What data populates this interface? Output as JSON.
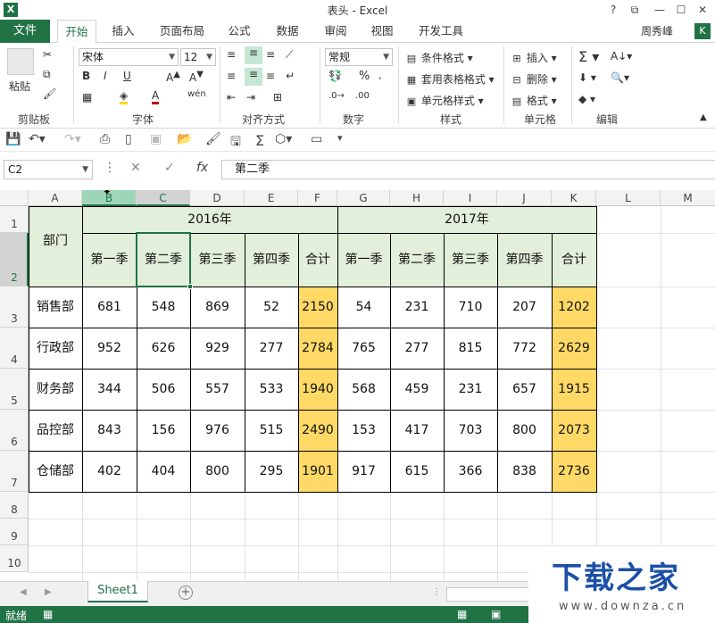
{
  "window": {
    "title": "表头 - Excel",
    "app_icon": "X",
    "controls": [
      "?",
      "⧉",
      "—",
      "☐",
      "✕"
    ]
  },
  "ribbon_tabs": {
    "file": "文件",
    "tabs": [
      "开始",
      "插入",
      "页面布局",
      "公式",
      "数据",
      "审阅",
      "视图",
      "开发工具"
    ],
    "active": "开始",
    "user": "周秀峰",
    "user_icon": "K"
  },
  "ribbon": {
    "clipboard": {
      "label": "剪贴板",
      "paste": "粘贴"
    },
    "font": {
      "label": "字体",
      "name": "宋体",
      "size": "12",
      "bold": "B",
      "italic": "I",
      "underline": "U"
    },
    "alignment": {
      "label": "对齐方式"
    },
    "number": {
      "label": "数字",
      "format": "常规",
      "percent": "%"
    },
    "styles": {
      "label": "样式",
      "cond_format": "条件格式",
      "table_format": "套用表格格式",
      "cell_styles": "单元格样式"
    },
    "cells": {
      "label": "单元格",
      "insert": "插入",
      "delete": "删除",
      "format": "格式"
    },
    "editing": {
      "label": "编辑"
    }
  },
  "formula_bar": {
    "name_box": "C2",
    "cancel": "✕",
    "enter": "✓",
    "fx": "fx",
    "content": "第二季"
  },
  "columns": [
    "A",
    "B",
    "C",
    "D",
    "E",
    "F",
    "G",
    "H",
    "I",
    "J",
    "K",
    "L",
    "M"
  ],
  "rows": [
    "1",
    "2",
    "3",
    "4",
    "5",
    "6",
    "7",
    "8",
    "9",
    "10"
  ],
  "table": {
    "dept_header": "部门",
    "year1": "2016年",
    "year2": "2017年",
    "quarters": [
      "第一季",
      "第二季",
      "第三季",
      "第四季",
      "合计",
      "第一季",
      "第二季",
      "第三季",
      "第四季",
      "合计"
    ],
    "data": [
      {
        "dept": "销售部",
        "v": [
          "681",
          "548",
          "869",
          "52",
          "2150",
          "54",
          "231",
          "710",
          "207",
          "1202"
        ]
      },
      {
        "dept": "行政部",
        "v": [
          "952",
          "626",
          "929",
          "277",
          "2784",
          "765",
          "277",
          "815",
          "772",
          "2629"
        ]
      },
      {
        "dept": "财务部",
        "v": [
          "344",
          "506",
          "557",
          "533",
          "1940",
          "568",
          "459",
          "231",
          "657",
          "1915"
        ]
      },
      {
        "dept": "品控部",
        "v": [
          "843",
          "156",
          "976",
          "515",
          "2490",
          "153",
          "417",
          "703",
          "800",
          "2073"
        ]
      },
      {
        "dept": "仓储部",
        "v": [
          "402",
          "404",
          "800",
          "295",
          "1901",
          "917",
          "615",
          "366",
          "838",
          "2736"
        ]
      }
    ]
  },
  "colors": {
    "excel_green": "#217346",
    "header_fill": "#e2efda",
    "sum_fill": "#ffd966"
  },
  "sheet_tabs": {
    "active": "Sheet1",
    "add": "+"
  },
  "status_bar": {
    "ready": "就绪"
  },
  "watermark": {
    "title": "下载之家",
    "url": "www.downza.cn"
  }
}
